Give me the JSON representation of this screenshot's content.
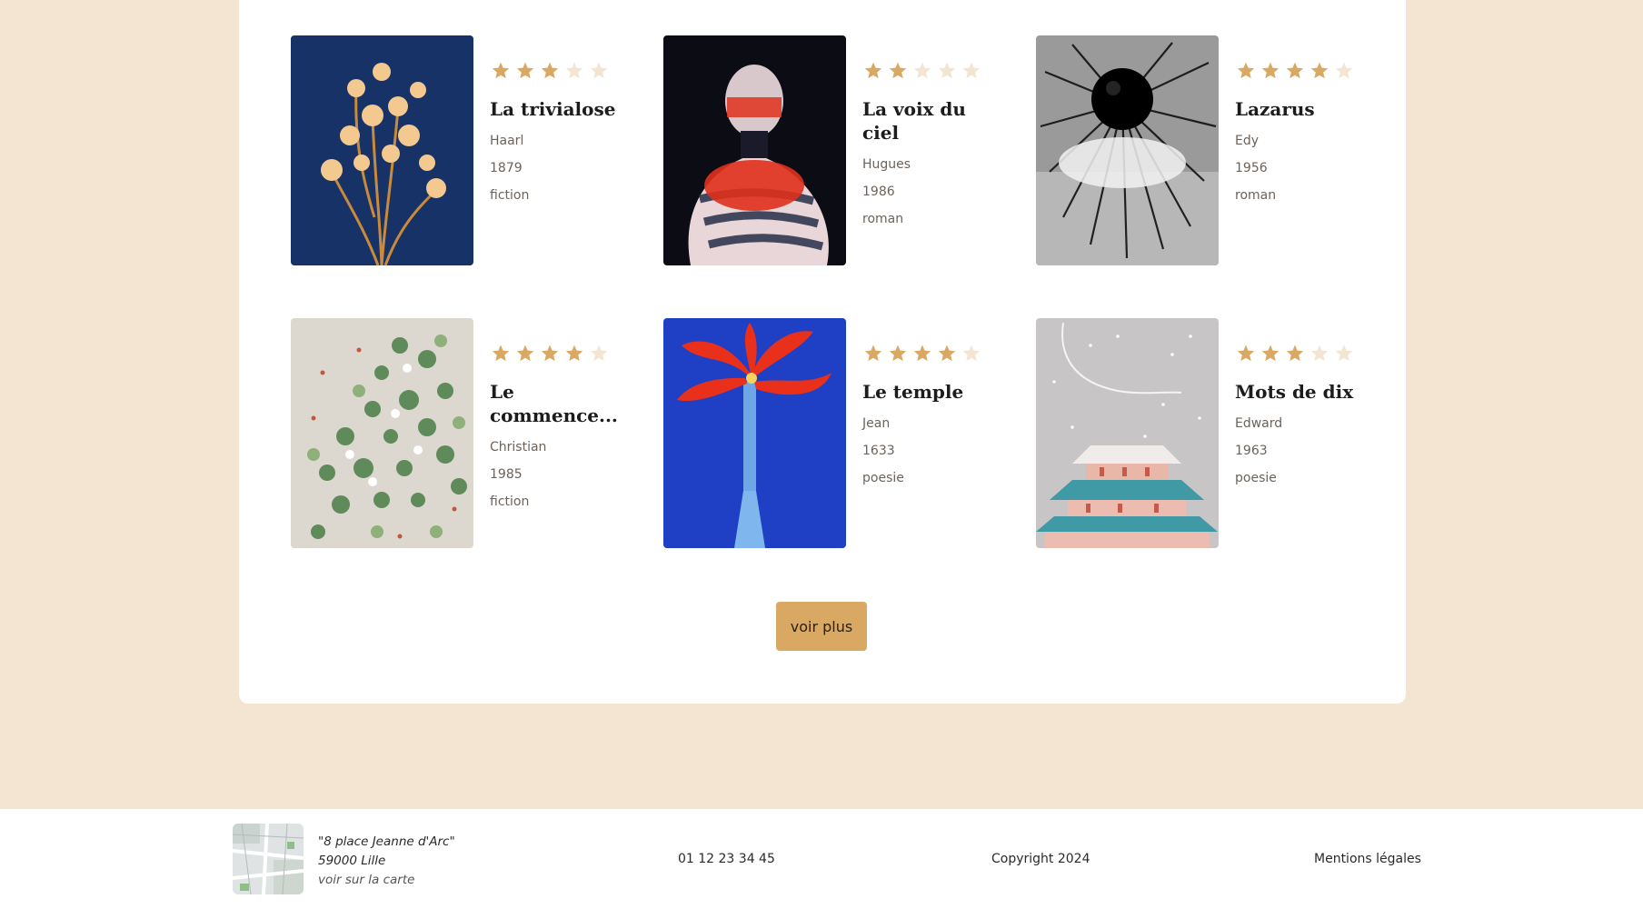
{
  "books": [
    {
      "title": "La trivialose",
      "author": "Haarl",
      "year": "1879",
      "genre": "fiction",
      "rating": 3,
      "max_rating": 5
    },
    {
      "title": "La voix du ciel",
      "author": "Hugues",
      "year": "1986",
      "genre": "roman",
      "rating": 2,
      "max_rating": 5
    },
    {
      "title": "Lazarus",
      "author": "Edy",
      "year": "1956",
      "genre": "roman",
      "rating": 4,
      "max_rating": 5
    },
    {
      "title": "Le commence...",
      "author": "Christian",
      "year": "1985",
      "genre": "fiction",
      "rating": 4,
      "max_rating": 5
    },
    {
      "title": "Le temple",
      "author": "Jean",
      "year": "1633",
      "genre": "poesie",
      "rating": 4,
      "max_rating": 5
    },
    {
      "title": "Mots de dix",
      "author": "Edward",
      "year": "1963",
      "genre": "poesie",
      "rating": 3,
      "max_rating": 5
    }
  ],
  "more_button": "voir plus",
  "footer": {
    "address_line1": "\"8 place Jeanne d'Arc\"",
    "address_line2": "59000 Lille",
    "map_link": "voir sur la carte",
    "phone": "01 12 23 34 45",
    "copyright": "Copyright 2024",
    "legal": "Mentions légales"
  },
  "colors": {
    "page_bg": "#f3e5d2",
    "star_filled": "#d9a862",
    "star_empty": "#f3e5d2",
    "button_bg": "#d9a862"
  }
}
